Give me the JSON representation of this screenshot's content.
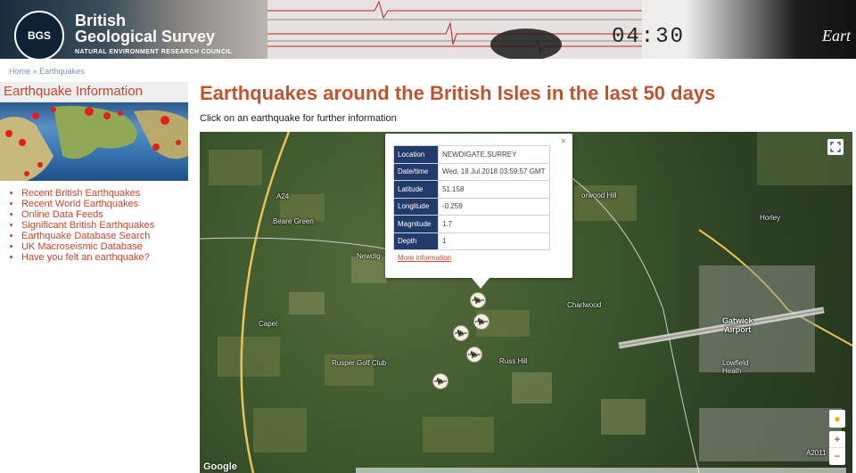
{
  "header": {
    "brand_line1": "British",
    "brand_line2": "Geological Survey",
    "logo_text": "BGS",
    "council": "NATURAL ENVIRONMENT RESEARCH COUNCIL",
    "banner_time": "04:30",
    "banner_tag": "Eart"
  },
  "breadcrumb": {
    "home": "Home",
    "sep": "»",
    "current": "Earthquakes"
  },
  "sidebar": {
    "title": "Earthquake Information",
    "items": [
      {
        "label": "Recent British Earthquakes"
      },
      {
        "label": "Recent World Earthquakes"
      },
      {
        "label": "Online Data Feeds"
      },
      {
        "label": "Significant British Earthquakes"
      },
      {
        "label": "Earthquake Database Search"
      },
      {
        "label": "UK Macroseismic Database"
      },
      {
        "label": "Have you felt an earthquake?"
      }
    ]
  },
  "main": {
    "title": "Earthquakes around the British Isles in the last 50 days",
    "subtitle": "Click on an earthquake for further information"
  },
  "popup": {
    "close": "×",
    "rows": [
      {
        "key": "Location",
        "value": "NEWDIGATE,SURREY"
      },
      {
        "key": "Date/time",
        "value": "Wed, 18 Jul 2018 03:59:57 GMT"
      },
      {
        "key": "Latitude",
        "value": "51.158"
      },
      {
        "key": "Longitude",
        "value": "-0.259"
      },
      {
        "key": "Magnitude",
        "value": "1.7"
      },
      {
        "key": "Depth",
        "value": "1"
      }
    ],
    "more": "More information"
  },
  "map": {
    "labels": {
      "beare_green": "Beare Green",
      "newdigate": "Newdig",
      "capel": "Capel",
      "rusper": "Rusper Golf Club",
      "russ_hill": "Russ Hill",
      "charlwood": "Charlwood",
      "horley": "Horley",
      "gatwick": "Gatwick\nAirport",
      "lowfield": "Lowfield\nHeath",
      "norwood_hill": "orwood Hill",
      "a24": "A24",
      "a2011": "A2011"
    },
    "zoom_in": "+",
    "zoom_out": "−",
    "google": "Google"
  },
  "colors": {
    "accent": "#c9452c",
    "popup_header": "#233b6b"
  }
}
